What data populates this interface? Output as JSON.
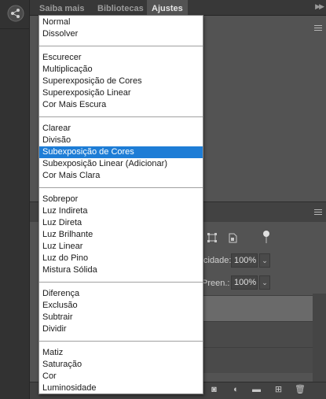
{
  "tabs": [
    {
      "label": "Saiba mais",
      "active": false
    },
    {
      "label": "Bibliotecas",
      "active": false
    },
    {
      "label": "Ajustes",
      "active": true
    }
  ],
  "blend_modes": {
    "groups": [
      [
        "Normal",
        "Dissolver"
      ],
      [
        "Escurecer",
        "Multiplicação",
        "Superexposição de Cores",
        "Superexposição Linear",
        "Cor Mais Escura"
      ],
      [
        "Clarear",
        "Divisão",
        "Subexposição de Cores",
        "Subexposição Linear (Adicionar)",
        "Cor Mais Clara"
      ],
      [
        "Sobrepor",
        "Luz Indireta",
        "Luz Direta",
        "Luz Brilhante",
        "Luz Linear",
        "Luz do Pino",
        "Mistura Sólida"
      ],
      [
        "Diferença",
        "Exclusão",
        "Subtrair",
        "Dividir"
      ],
      [
        "Matiz",
        "Saturação",
        "Cor",
        "Luminosidade"
      ]
    ],
    "selected": "Subexposição de Cores",
    "selection_color": "#1e7dd6"
  },
  "layers": {
    "opacity_label": "cidade:",
    "opacity_value": "100%",
    "fill_label": "Preen.:",
    "fill_value": "100%"
  },
  "icons": {
    "share": "share-icon",
    "lock_artboard": "artboard-lock-icon",
    "lock_all": "lock-icon",
    "toggle": "toggle-icon",
    "mask": "mask-icon",
    "adjustment": "adjustment-layer-icon",
    "folder": "folder-icon",
    "new_layer": "new-layer-icon",
    "delete": "trash-icon"
  }
}
